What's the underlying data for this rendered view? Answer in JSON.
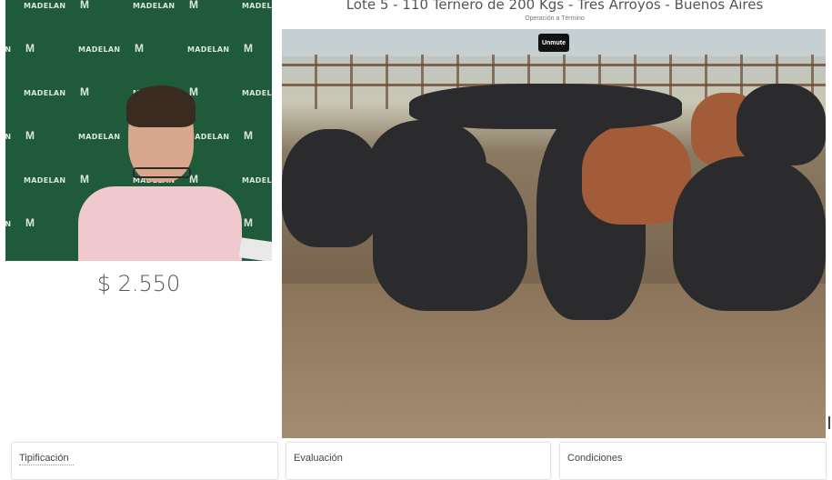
{
  "header": {
    "title": "Lote 5 - 110 Ternero de 200 Kgs - Tres Arroyos - Buenos Aires",
    "subtitle": "Operación a Término"
  },
  "presenter": {
    "backdrop_brand": "MADELAN",
    "backdrop_mark": "M",
    "price": "$ 2.550"
  },
  "video": {
    "unmute_label": "Unmute"
  },
  "cards": [
    {
      "label": "Tipificación"
    },
    {
      "label": "Evaluación"
    },
    {
      "label": "Condiciones"
    }
  ]
}
